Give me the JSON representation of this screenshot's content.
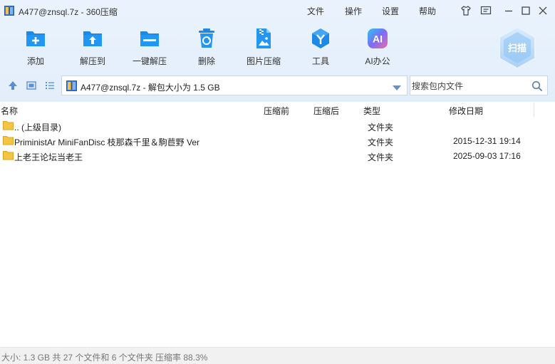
{
  "window": {
    "title": "A477@znsql.7z - 360压缩",
    "menu": [
      "文件",
      "操作",
      "设置",
      "帮助"
    ]
  },
  "toolbar": {
    "items": [
      {
        "label": "添加",
        "icon": "add-archive-icon"
      },
      {
        "label": "解压到",
        "icon": "extract-to-icon"
      },
      {
        "label": "一键解压",
        "icon": "one-click-extract-icon"
      },
      {
        "label": "删除",
        "icon": "delete-icon"
      },
      {
        "label": "图片压缩",
        "icon": "image-compress-icon"
      },
      {
        "label": "工具",
        "icon": "tools-icon"
      },
      {
        "label": "AI办公",
        "icon": "ai-office-icon"
      }
    ],
    "ai_icon_text": "AI",
    "scan_label": "扫描"
  },
  "address": {
    "path": "A477@znsql.7z - 解包大小为 1.5 GB"
  },
  "search": {
    "placeholder": "搜索包内文件"
  },
  "columns": {
    "name": "名称",
    "compressed_before": "压缩前",
    "compressed_after": "压缩后",
    "type": "类型",
    "modified": "修改日期"
  },
  "files": [
    {
      "name": ".. (上级目录)",
      "type": "文件夹",
      "modified": ""
    },
    {
      "name": "PriministAr MiniFanDisc 枝那森千里＆駒苣野 Ver",
      "type": "文件夹",
      "modified": "2015-12-31 19:14"
    },
    {
      "name": "上老王论坛当老王",
      "type": "文件夹",
      "modified": "2025-09-03 17:16"
    }
  ],
  "status": {
    "text": "大小: 1.3 GB 共 27 个文件和 6 个文件夹 压缩率 88.3%"
  },
  "colors": {
    "accent": "#1e88e5",
    "toolbar_bg": "#e6f0fc",
    "folder": "#f4c542"
  }
}
